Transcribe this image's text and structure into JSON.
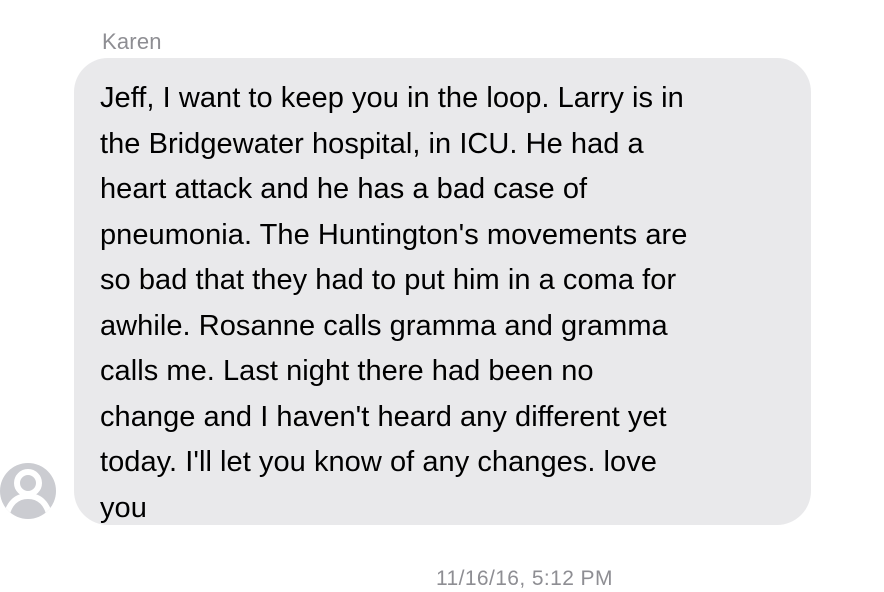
{
  "conversation": {
    "sender": {
      "name": "Karen",
      "avatar_icon": "person-placeholder-icon"
    },
    "message": {
      "lines": [
        "Jeff, I want to keep you in the loop.  Larry is in",
        "the Bridgewater hospital, in ICU.  He had a",
        "heart attack and he has a bad case of",
        "pneumonia.  The Huntington's movements are",
        "so bad that they had to put him in a coma for",
        "awhile.  Rosanne calls gramma and gramma",
        "calls me.  Last night there had been no",
        "change and I haven't heard any different yet",
        "today.  I'll let you know of any changes.   love",
        "you"
      ]
    },
    "timestamp": "11/16/16, 5:12 PM"
  },
  "colors": {
    "bubble_background": "#e9e9eb",
    "secondary_text": "#8e8e93",
    "avatar_background": "#cbccd1",
    "avatar_silhouette": "#ffffff",
    "message_text": "#000000"
  }
}
